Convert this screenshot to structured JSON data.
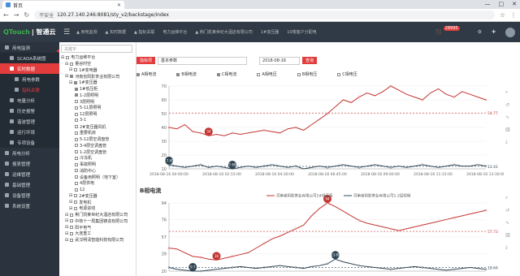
{
  "browser": {
    "tab_title": "首页",
    "insecure_label": "不安全",
    "url": "120.27.140.246:8081/sty_v2/backstage/index",
    "window_controls": [
      "—",
      "□",
      "✕"
    ],
    "tab_close": "✕",
    "nav_glyphs": [
      "←",
      "→",
      "↻"
    ],
    "menu_glyph": "≡",
    "addr_icons": [
      "☆",
      "⋮"
    ]
  },
  "app": {
    "logo_q": "QTouch",
    "logo_text": "| 智通云",
    "menu_icon": "☰",
    "breadcrumbs": [
      "▲ 用电监测",
      "▲ 实时数据",
      "▲ 指标关联",
      "电力运维平台",
      "▲ 荆门凯莱世纪大酒店有限公司",
      "1#变压器",
      "10楼客户分配电"
    ],
    "badge": "28995",
    "top_icons": [
      "⬛",
      "⚙",
      "✚"
    ],
    "tree_arrow": "◀"
  },
  "sidebar": [
    {
      "label": "用电监测",
      "level": 0,
      "active": false
    },
    {
      "label": "SCADA系统图",
      "level": 1,
      "active": false
    },
    {
      "label": "实时数据",
      "level": 1,
      "active": true
    },
    {
      "label": "用电参数",
      "level": 2,
      "active": false
    },
    {
      "label": "指标关联",
      "level": 2,
      "active": false,
      "highlight": true
    },
    {
      "label": "电量分析",
      "level": 1,
      "active": false
    },
    {
      "label": "历史报警",
      "level": 1,
      "active": false
    },
    {
      "label": "谐波管理",
      "level": 1,
      "active": false
    },
    {
      "label": "运行环境",
      "level": 1,
      "active": false
    },
    {
      "label": "专项设备",
      "level": 1,
      "active": false
    },
    {
      "label": "用电分析",
      "level": 0,
      "active": false
    },
    {
      "label": "报表管理",
      "level": 0,
      "active": false
    },
    {
      "label": "运维管理",
      "level": 0,
      "active": false
    },
    {
      "label": "基础管理",
      "level": 0,
      "active": false
    },
    {
      "label": "设备管理",
      "level": 0,
      "active": false
    },
    {
      "label": "系统设置",
      "level": 0,
      "active": false
    }
  ],
  "tree": {
    "search_placeholder": "关键字",
    "items": [
      {
        "label": "电力运维平台",
        "indent": 0,
        "checked": false
      },
      {
        "label": "量谷时空",
        "indent": 1,
        "checked": false
      },
      {
        "label": "1#变电器",
        "indent": 2,
        "checked": false
      },
      {
        "label": "河南省阳影茶业有限公司",
        "indent": 1,
        "checked": true
      },
      {
        "label": "1#变压器",
        "indent": 2,
        "checked": true
      },
      {
        "label": "1#低压柜",
        "indent": 3,
        "checked": true
      },
      {
        "label": "1-2层照明",
        "indent": 3,
        "checked": true
      },
      {
        "label": "3层照明",
        "indent": 3,
        "checked": false
      },
      {
        "label": "5-11层照明",
        "indent": 3,
        "checked": false
      },
      {
        "label": "12层照明",
        "indent": 3,
        "checked": false
      },
      {
        "label": "3-1",
        "indent": 3,
        "checked": false
      },
      {
        "label": "2#变压器风机",
        "indent": 3,
        "checked": false
      },
      {
        "label": "重要机房",
        "indent": 3,
        "checked": false
      },
      {
        "label": "5-12层空调盘管",
        "indent": 3,
        "checked": false
      },
      {
        "label": "3-4层空调盘管",
        "indent": 3,
        "checked": false
      },
      {
        "label": "1-2层空调盘管",
        "indent": 3,
        "checked": false
      },
      {
        "label": "冷冻机",
        "indent": 3,
        "checked": false
      },
      {
        "label": "事故照明",
        "indent": 3,
        "checked": false
      },
      {
        "label": "消防中心",
        "indent": 3,
        "checked": false
      },
      {
        "label": "设备用照明（地下室）",
        "indent": 3,
        "checked": false
      },
      {
        "label": "4层供电",
        "indent": 3,
        "checked": false
      },
      {
        "label": "12",
        "indent": 3,
        "checked": false
      },
      {
        "label": "2#变压器",
        "indent": 2,
        "checked": false
      },
      {
        "label": "发电机",
        "indent": 2,
        "checked": false
      },
      {
        "label": "电源进线",
        "indent": 2,
        "checked": false
      },
      {
        "label": "荆门凯莱世纪大酒店有限公司",
        "indent": 1,
        "checked": false
      },
      {
        "label": "中核十一局集团铸造有限公司",
        "indent": 1,
        "checked": false
      },
      {
        "label": "阳平电气",
        "indent": 1,
        "checked": false
      },
      {
        "label": "大连重工",
        "indent": 1,
        "checked": false
      },
      {
        "label": "武汉明清智能科技有限公司",
        "indent": 1,
        "checked": false
      }
    ]
  },
  "filters": {
    "indicator_btn": "指标项",
    "indicator_value": "基本参数",
    "date_value": "2018-08-16",
    "query_btn": "查询"
  },
  "checks": [
    {
      "label": "A相电流",
      "checked": true
    },
    {
      "label": "B相电流",
      "checked": true
    },
    {
      "label": "C相电流",
      "checked": true
    },
    {
      "label": "A相电压",
      "checked": false
    },
    {
      "label": "B相电压",
      "checked": false
    },
    {
      "label": "C相电压",
      "checked": false
    }
  ],
  "chart_data": [
    {
      "type": "line",
      "title": "",
      "x": [
        "2018-08-16 00:00:00",
        "2018-08-16 02:15:00",
        "2018-08-16 04:30:00",
        "2018-08-16 06:45:00",
        "2018-08-16 09:00:00",
        "2018-08-16 11:15:00",
        "2018-08-16 13:30:00"
      ],
      "ylim": [
        10,
        70
      ],
      "yticks": [
        10,
        20,
        30,
        40,
        50,
        60,
        70
      ],
      "series": [
        {
          "color": "#c23531",
          "values": [
            40,
            39,
            42,
            37,
            36,
            34,
            35,
            34,
            36,
            35,
            36,
            37,
            38,
            37,
            36,
            39,
            40,
            38,
            42,
            46,
            50,
            55,
            60,
            58,
            62,
            65,
            63,
            66,
            70,
            67,
            64,
            62,
            60,
            65,
            68,
            64,
            62,
            66,
            64,
            62,
            60
          ],
          "max_label": "",
          "min_label": "34"
        },
        {
          "color": "#2f4554",
          "values": [
            13,
            12,
            11,
            12,
            13,
            11,
            12,
            11,
            10,
            11,
            12,
            11,
            12,
            13,
            12,
            11,
            12,
            10,
            11,
            12,
            11,
            12,
            13,
            12,
            11,
            12,
            13,
            12,
            11,
            12,
            11,
            12,
            13,
            12,
            11,
            12,
            13,
            12,
            12,
            13,
            12
          ],
          "min_label": "7.69",
          "max_label": "17.49"
        }
      ],
      "markline": "54.77",
      "markline2": "12.41"
    },
    {
      "type": "line",
      "title": "B相电流",
      "legend": [
        "河南省阳影茶业有限公司1#低压柜",
        "河南省阳影茶业有限公司1-2层照明"
      ],
      "ylim": [
        20,
        94
      ],
      "yticks": [
        20,
        39,
        57,
        76,
        94
      ],
      "series": [
        {
          "color": "#c23531",
          "values": [
            45,
            44,
            40,
            36,
            35,
            33,
            32,
            34,
            36,
            38,
            40,
            45,
            50,
            55,
            58,
            62,
            66,
            70,
            80,
            88,
            94,
            90,
            85,
            80,
            75,
            72,
            70,
            68,
            66,
            64,
            66,
            68,
            70,
            72,
            74,
            76,
            78,
            80,
            82,
            84,
            86
          ],
          "max_label": "94",
          "min_label": "30"
        },
        {
          "color": "#2f4554",
          "values": [
            24,
            22,
            21,
            20,
            20,
            21,
            22,
            23,
            24,
            25,
            24,
            23,
            24,
            25,
            26,
            25,
            24,
            23,
            25,
            26,
            28,
            33,
            30,
            28,
            26,
            25,
            24,
            23,
            22,
            23,
            24,
            25,
            24,
            23,
            22,
            21,
            22,
            23,
            24,
            23,
            22
          ],
          "min_label": "9.7",
          "max_label": "13.89"
        }
      ],
      "markline": "57.73",
      "markline2": "18.64"
    }
  ]
}
